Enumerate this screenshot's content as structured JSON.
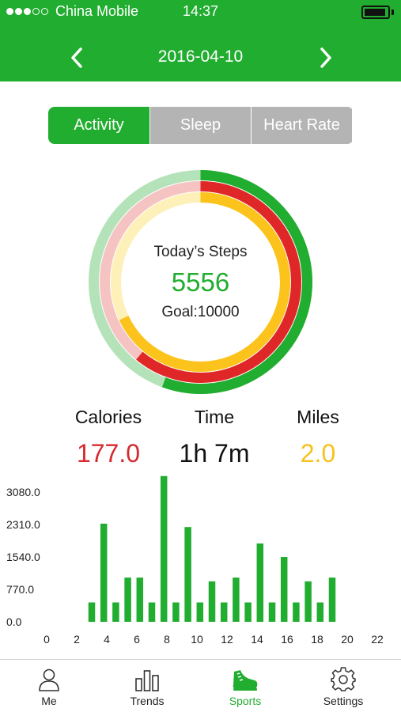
{
  "status_bar": {
    "carrier": "China Mobile",
    "time": "14:37",
    "signal_bars": 3,
    "signal_max": 5,
    "battery_level": 0.92
  },
  "header": {
    "date": "2016-04-10",
    "prev_icon": "chevron-left-icon",
    "next_icon": "chevron-right-icon"
  },
  "tabs": [
    {
      "label": "Activity",
      "active": true
    },
    {
      "label": "Sleep",
      "active": false
    },
    {
      "label": "Heart Rate",
      "active": false
    }
  ],
  "summary": {
    "title": "Today’s Steps",
    "steps": "5556",
    "goal": "Goal:10000"
  },
  "rings": {
    "steps_fraction": 0.5556,
    "calories_fraction": 0.61,
    "miles_fraction": 0.68,
    "colors": {
      "steps": "#21ad2f",
      "steps_track": "#b5e3b9",
      "calories": "#e02727",
      "calories_track": "#f6c3c3",
      "miles": "#fbc31b",
      "miles_track": "#fdf0b8"
    }
  },
  "stats": {
    "calories": {
      "label": "Calories",
      "value": "177.0",
      "color": "#d62a2e"
    },
    "time": {
      "label": "Time",
      "value": "1h 7m",
      "color": "#111111"
    },
    "miles": {
      "label": "Miles",
      "value": "2.0",
      "color": "#f6c21c"
    }
  },
  "chart_data": {
    "type": "bar",
    "title": "",
    "xlabel": "",
    "ylabel": "",
    "xlim": [
      0,
      22
    ],
    "ylim": [
      0,
      3080
    ],
    "x_ticks": [
      0,
      2,
      4,
      6,
      8,
      10,
      12,
      14,
      16,
      18,
      20,
      22
    ],
    "y_ticks": [
      "0.0",
      "770.0",
      "1540.0",
      "2310.0",
      "3080.0"
    ],
    "y_tick_values": [
      0,
      770,
      1540,
      2310,
      3080
    ],
    "grid": false,
    "color": "#21ad2f",
    "x": [
      3,
      4,
      5,
      6,
      7,
      8,
      9,
      10,
      11,
      12,
      13,
      14,
      15,
      16,
      17,
      18,
      19,
      20,
      21
    ],
    "values": [
      460,
      2330,
      460,
      1050,
      1050,
      460,
      3460,
      460,
      2250,
      460,
      960,
      460,
      1050,
      460,
      1860,
      460,
      1540,
      460,
      960,
      460,
      1050
    ]
  },
  "tabbar": [
    {
      "label": "Me",
      "icon": "person-icon",
      "active": false
    },
    {
      "label": "Trends",
      "icon": "bar-chart-icon",
      "active": false
    },
    {
      "label": "Sports",
      "icon": "sneaker-icon",
      "active": true
    },
    {
      "label": "Settings",
      "icon": "gear-icon",
      "active": false
    }
  ]
}
